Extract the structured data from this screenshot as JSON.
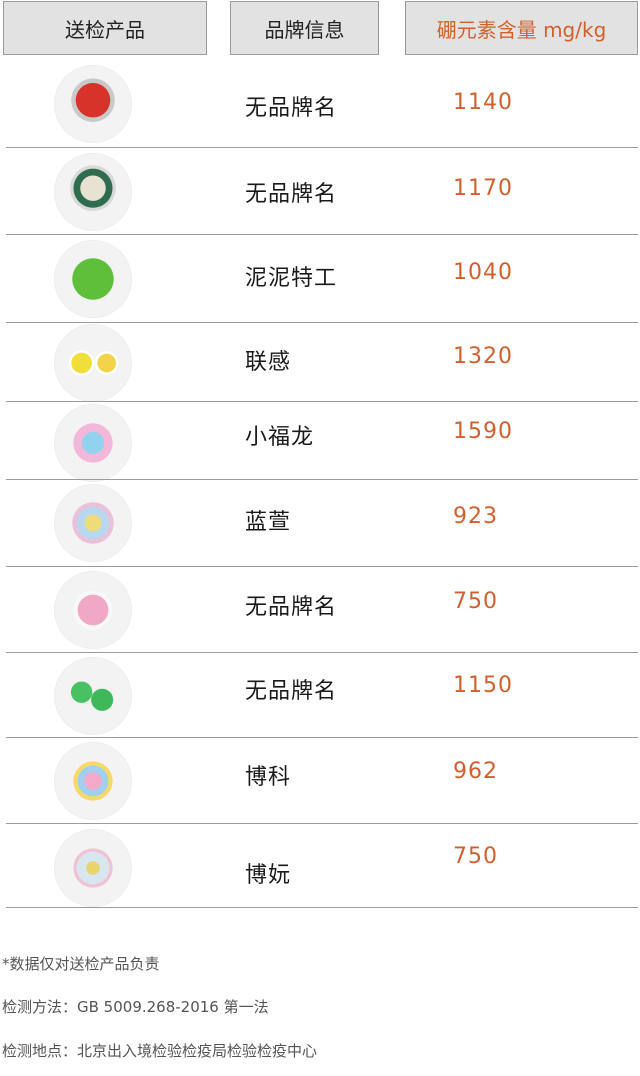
{
  "headers": {
    "product": "送检产品",
    "brand": "品牌信息",
    "boron": "硼元素含量 mg/kg"
  },
  "rows": [
    {
      "brand": "无品牌名",
      "value": "1140"
    },
    {
      "brand": "无品牌名",
      "value": "1170"
    },
    {
      "brand": "泥泥特工",
      "value": "1040"
    },
    {
      "brand": "联感",
      "value": "1320"
    },
    {
      "brand": "小福龙",
      "value": "1590"
    },
    {
      "brand": "蓝萱",
      "value": "923"
    },
    {
      "brand": "无品牌名",
      "value": "750"
    },
    {
      "brand": "无品牌名",
      "value": "1150"
    },
    {
      "brand": "博科",
      "value": "962"
    },
    {
      "brand": "博妧",
      "value": "750"
    }
  ],
  "footer": {
    "disclaimer": "*数据仅对送检产品负责",
    "method": "检测方法：GB 5009.268-2016 第一法",
    "location": "检测地点：北京出入境检验检疫局检验检疫中心"
  },
  "colors": {
    "accent": "#d3602c",
    "header_bg": "#e2e2e2",
    "divider": "#9b9b9b"
  }
}
